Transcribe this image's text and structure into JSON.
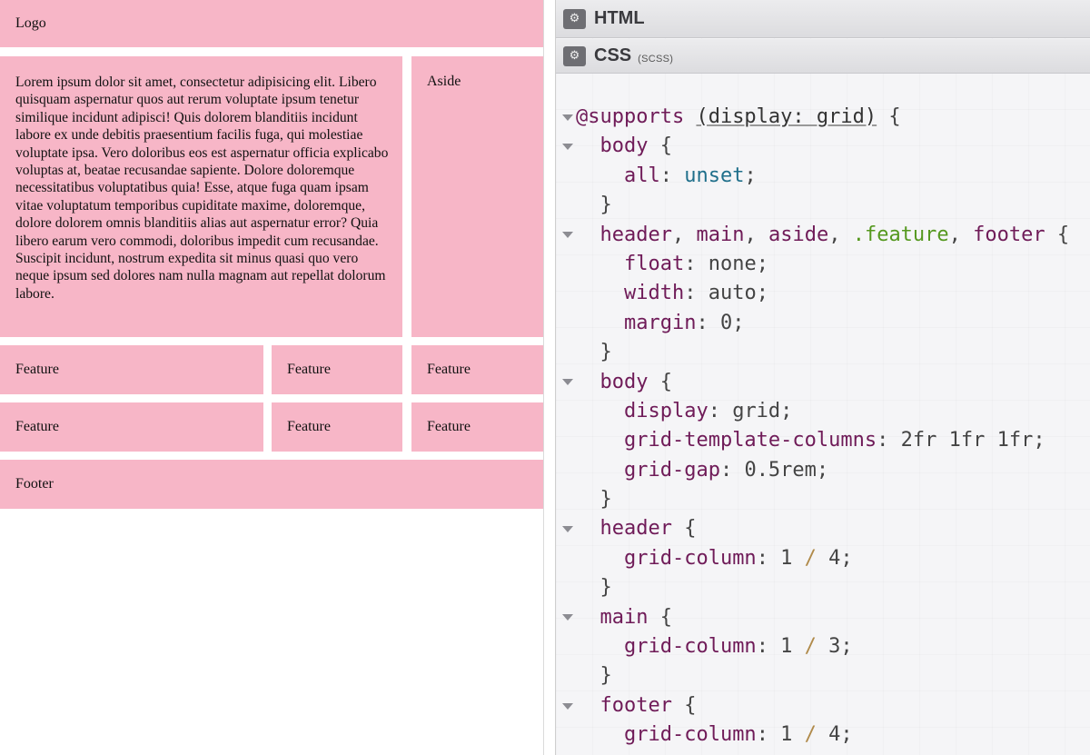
{
  "preview": {
    "logo": "Logo",
    "main_text": "Lorem ipsum dolor sit amet, consectetur adipisicing elit. Libero quisquam aspernatur quos aut rerum voluptate ipsum tenetur similique incidunt adipisci! Quis dolorem blanditiis incidunt labore ex unde debitis praesentium facilis fuga, qui molestiae voluptate ipsa. Vero doloribus eos est aspernatur officia explicabo voluptas at, beatae recusandae sapiente. Dolore doloremque necessitatibus voluptatibus quia! Esse, atque fuga quam ipsam vitae voluptatum temporibus cupiditate maxime, doloremque, dolore dolorem omnis blanditiis alias aut aspernatur error? Quia libero earum vero commodi, doloribus impedit cum recusandae. Suscipit incidunt, nostrum expedita sit minus quasi quo vero neque ipsum sed dolores nam nulla magnam aut repellat dolorum labore.",
    "aside": "Aside",
    "features": [
      "Feature",
      "Feature",
      "Feature",
      "Feature",
      "Feature",
      "Feature"
    ],
    "footer": "Footer",
    "box_color": "#f7b6c7"
  },
  "editor": {
    "html_panel": {
      "title": "HTML",
      "icon": "gear-icon"
    },
    "css_panel": {
      "title": "CSS",
      "subtitle": "(SCSS)",
      "icon": "gear-icon"
    },
    "code_lines": [
      {
        "fold": true,
        "tokens": [
          [
            "kw",
            "@supports "
          ],
          [
            "ul",
            "(display: grid)"
          ],
          [
            "pn",
            " {"
          ]
        ]
      },
      {
        "fold": true,
        "tokens": [
          [
            "pn",
            "  "
          ],
          [
            "kw",
            "body"
          ],
          [
            "pn",
            " {"
          ]
        ]
      },
      {
        "fold": false,
        "tokens": [
          [
            "pn",
            "    "
          ],
          [
            "kw",
            "all"
          ],
          [
            "pn",
            ": "
          ],
          [
            "val",
            "unset"
          ],
          [
            "pn",
            ";"
          ]
        ]
      },
      {
        "fold": false,
        "tokens": [
          [
            "pn",
            "  }"
          ]
        ]
      },
      {
        "fold": true,
        "tokens": [
          [
            "pn",
            "  "
          ],
          [
            "kw",
            "header"
          ],
          [
            "pn",
            ", "
          ],
          [
            "kw",
            "main"
          ],
          [
            "pn",
            ", "
          ],
          [
            "kw",
            "aside"
          ],
          [
            "pn",
            ", "
          ],
          [
            "sel",
            ".feature"
          ],
          [
            "pn",
            ", "
          ],
          [
            "kw",
            "footer"
          ],
          [
            "pn",
            " {"
          ]
        ]
      },
      {
        "fold": false,
        "tokens": [
          [
            "pn",
            "    "
          ],
          [
            "kw",
            "float"
          ],
          [
            "pn",
            ": none;"
          ]
        ]
      },
      {
        "fold": false,
        "tokens": [
          [
            "pn",
            "    "
          ],
          [
            "kw",
            "width"
          ],
          [
            "pn",
            ": auto;"
          ]
        ]
      },
      {
        "fold": false,
        "tokens": [
          [
            "pn",
            "    "
          ],
          [
            "kw",
            "margin"
          ],
          [
            "pn",
            ": 0;"
          ]
        ]
      },
      {
        "fold": false,
        "tokens": [
          [
            "pn",
            "  }"
          ]
        ]
      },
      {
        "fold": true,
        "tokens": [
          [
            "pn",
            "  "
          ],
          [
            "kw",
            "body"
          ],
          [
            "pn",
            " {"
          ]
        ]
      },
      {
        "fold": false,
        "tokens": [
          [
            "pn",
            "    "
          ],
          [
            "kw",
            "display"
          ],
          [
            "pn",
            ": grid;"
          ]
        ]
      },
      {
        "fold": false,
        "tokens": [
          [
            "pn",
            "    "
          ],
          [
            "kw",
            "grid-template-columns"
          ],
          [
            "pn",
            ": 2fr 1fr 1fr;"
          ]
        ]
      },
      {
        "fold": false,
        "tokens": [
          [
            "pn",
            "    "
          ],
          [
            "kw",
            "grid-gap"
          ],
          [
            "pn",
            ": 0.5rem;"
          ]
        ]
      },
      {
        "fold": false,
        "tokens": [
          [
            "pn",
            "  }"
          ]
        ]
      },
      {
        "fold": true,
        "tokens": [
          [
            "pn",
            "  "
          ],
          [
            "kw",
            "header"
          ],
          [
            "pn",
            " {"
          ]
        ]
      },
      {
        "fold": false,
        "tokens": [
          [
            "pn",
            "    "
          ],
          [
            "kw",
            "grid-column"
          ],
          [
            "pn",
            ": 1 "
          ],
          [
            "op",
            "/"
          ],
          [
            "pn",
            " 4;"
          ]
        ]
      },
      {
        "fold": false,
        "tokens": [
          [
            "pn",
            "  }"
          ]
        ]
      },
      {
        "fold": true,
        "tokens": [
          [
            "pn",
            "  "
          ],
          [
            "kw",
            "main"
          ],
          [
            "pn",
            " {"
          ]
        ]
      },
      {
        "fold": false,
        "tokens": [
          [
            "pn",
            "    "
          ],
          [
            "kw",
            "grid-column"
          ],
          [
            "pn",
            ": 1 "
          ],
          [
            "op",
            "/"
          ],
          [
            "pn",
            " 3;"
          ]
        ]
      },
      {
        "fold": false,
        "tokens": [
          [
            "pn",
            "  }"
          ]
        ]
      },
      {
        "fold": true,
        "tokens": [
          [
            "pn",
            "  "
          ],
          [
            "kw",
            "footer"
          ],
          [
            "pn",
            " {"
          ]
        ]
      },
      {
        "fold": false,
        "tokens": [
          [
            "pn",
            "    "
          ],
          [
            "kw",
            "grid-column"
          ],
          [
            "pn",
            ": 1 "
          ],
          [
            "op",
            "/"
          ],
          [
            "pn",
            " 4;"
          ]
        ]
      }
    ]
  }
}
